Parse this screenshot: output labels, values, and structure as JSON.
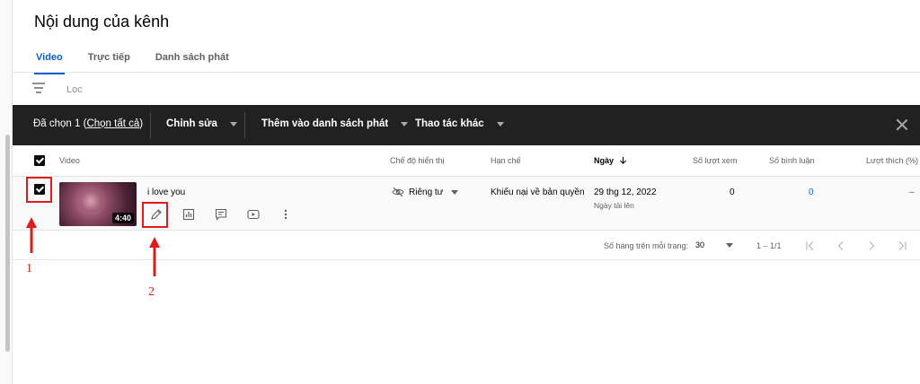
{
  "page": {
    "title": "Nội dung của kênh"
  },
  "tabs": [
    {
      "label": "Video",
      "active": true
    },
    {
      "label": "Trực tiếp",
      "active": false
    },
    {
      "label": "Danh sách phát",
      "active": false
    }
  ],
  "filter": {
    "icon": "filter-icon",
    "label": "Lọc"
  },
  "action_bar": {
    "selected_prefix": "Đã chọn 1 (",
    "select_all": "Chọn tất cả",
    "selected_suffix": ")",
    "edit": "Chỉnh sửa",
    "add_to_playlist": "Thêm vào danh sách phát",
    "more_actions": "Thao tác khác",
    "close_icon": "close-icon"
  },
  "table": {
    "headers": {
      "video": "Video",
      "visibility": "Chế độ hiển thị",
      "restrictions": "Hạn chế",
      "date": "Ngày",
      "views": "Số lượt xem",
      "comments": "Số bình luận",
      "likes": "Lượt thích (%)"
    },
    "rows": [
      {
        "title": "i love you",
        "duration": "4:40",
        "visibility": "Riêng tư",
        "restriction": "Khiếu nại về bản quyền",
        "date": "29 thg 12, 2022",
        "date_sub": "Ngày tải lên",
        "views": "0",
        "comments": "0",
        "likes": "–"
      }
    ]
  },
  "pagination": {
    "rows_label": "Số hàng trên mỗi trang:",
    "rows_value": "30",
    "range": "1 – 1/1"
  },
  "annotations": {
    "marker_1": "1",
    "marker_2": "2",
    "color": "#e01b1b"
  },
  "colors": {
    "accent": "#065fd4",
    "action_bar_bg": "#212121"
  }
}
